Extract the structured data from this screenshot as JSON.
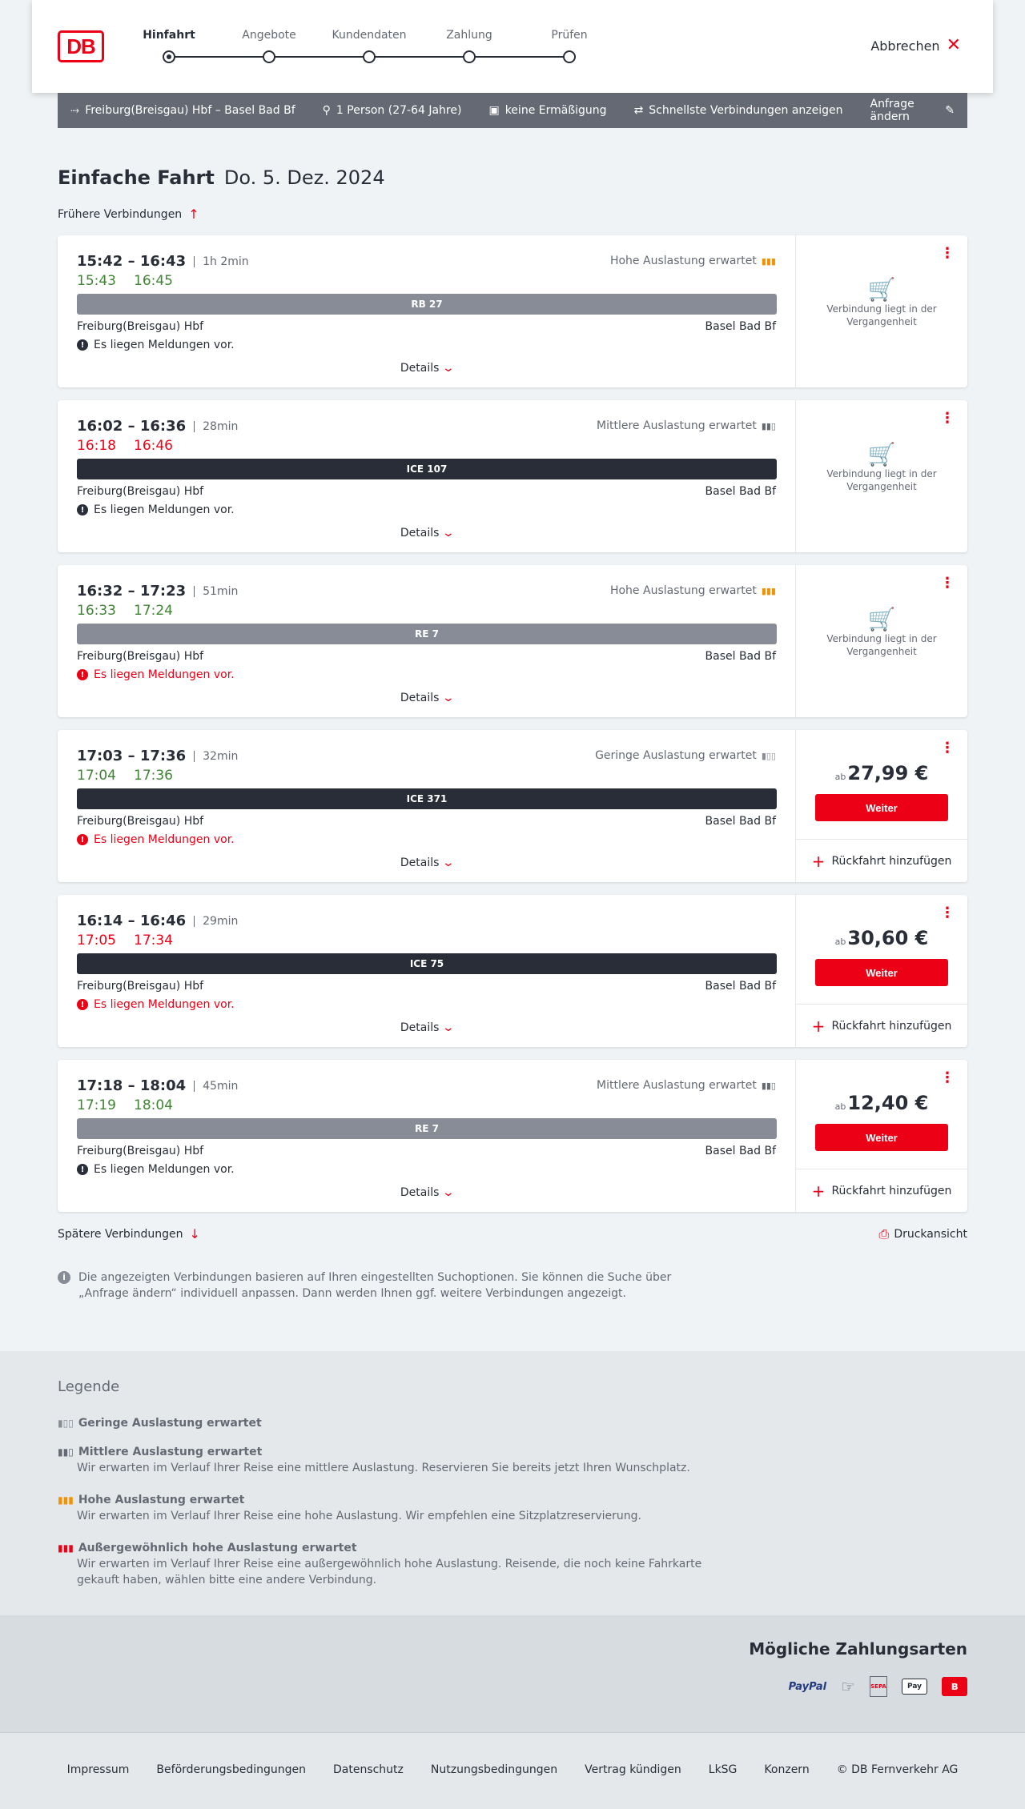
{
  "header": {
    "logo": "DB",
    "cancel_label": "Abbrechen",
    "steps": [
      {
        "label": "Hinfahrt"
      },
      {
        "label": "Angebote"
      },
      {
        "label": "Kundendaten"
      },
      {
        "label": "Zahlung"
      },
      {
        "label": "Prüfen"
      }
    ]
  },
  "search": {
    "route": "Freiburg(Breisgau) Hbf – Basel Bad Bf",
    "travellers": "1 Person (27-64 Jahre)",
    "discount": "keine Ermäßigung",
    "filter": "Schnellste Verbindungen anzeigen",
    "change": "Anfrage ändern"
  },
  "title": {
    "trip": "Einfache Fahrt",
    "date": "Do. 5. Dez. 2024"
  },
  "earlier": "Frühere Verbindungen",
  "later": "Spätere Verbindungen",
  "print": "Druckansicht",
  "details_label": "Details",
  "weiter_label": "Weiter",
  "return_label": "Rückfahrt hinzufügen",
  "past_label": "Verbindung liegt in der Vergangenheit",
  "ab_label": "ab",
  "connections": [
    {
      "time": "15:42 – 16:43",
      "duration": "1h 2min",
      "rt_dep": "15:43",
      "rt_arr": "16:45",
      "rt_status": "green",
      "load": "Hohe Auslastung erwartet",
      "load_level": "high",
      "train": "RB 27",
      "train_style": "grey",
      "from": "Freiburg(Breisgau) Hbf",
      "to": "Basel Bad Bf",
      "notice": "Es liegen Meldungen vor.",
      "notice_style": "dark",
      "price": ""
    },
    {
      "time": "16:02 – 16:36",
      "duration": "28min",
      "rt_dep": "16:18",
      "rt_arr": "16:46",
      "rt_status": "red",
      "load": "Mittlere Auslastung erwartet",
      "load_level": "medium",
      "train": "ICE 107",
      "train_style": "dark",
      "from": "Freiburg(Breisgau) Hbf",
      "to": "Basel Bad Bf",
      "notice": "Es liegen Meldungen vor.",
      "notice_style": "dark",
      "price": ""
    },
    {
      "time": "16:32 – 17:23",
      "duration": "51min",
      "rt_dep": "16:33",
      "rt_arr": "17:24",
      "rt_status": "green",
      "load": "Hohe Auslastung erwartet",
      "load_level": "high",
      "train": "RE 7",
      "train_style": "grey",
      "from": "Freiburg(Breisgau) Hbf",
      "to": "Basel Bad Bf",
      "notice": "Es liegen Meldungen vor.",
      "notice_style": "red",
      "price": ""
    },
    {
      "time": "17:03 – 17:36",
      "duration": "32min",
      "rt_dep": "17:04",
      "rt_arr": "17:36",
      "rt_status": "green",
      "load": "Geringe Auslastung erwartet",
      "load_level": "low",
      "train": "ICE 371",
      "train_style": "dark",
      "from": "Freiburg(Breisgau) Hbf",
      "to": "Basel Bad Bf",
      "notice": "Es liegen Meldungen vor.",
      "notice_style": "red",
      "price": "27,99 €"
    },
    {
      "time": "16:14 – 16:46",
      "duration": "29min",
      "rt_dep": "17:05",
      "rt_arr": "17:34",
      "rt_status": "red",
      "load": "",
      "load_level": "",
      "train": "ICE 75",
      "train_style": "dark",
      "from": "Freiburg(Breisgau) Hbf",
      "to": "Basel Bad Bf",
      "notice": "Es liegen Meldungen vor.",
      "notice_style": "red",
      "price": "30,60 €"
    },
    {
      "time": "17:18 – 18:04",
      "duration": "45min",
      "rt_dep": "17:19",
      "rt_arr": "18:04",
      "rt_status": "green",
      "load": "Mittlere Auslastung erwartet",
      "load_level": "medium",
      "train": "RE 7",
      "train_style": "grey",
      "from": "Freiburg(Breisgau) Hbf",
      "to": "Basel Bad Bf",
      "notice": "Es liegen Meldungen vor.",
      "notice_style": "dark",
      "price": "12,40 €"
    }
  ],
  "info_text": "Die angezeigten Verbindungen basieren auf Ihren eingestellten Suchoptionen. Sie können die Suche über „Anfrage ändern“ individuell anpassen. Dann werden Ihnen ggf. weitere Verbindungen angezeigt.",
  "legend": {
    "title": "Legende",
    "items": [
      {
        "label": "Geringe Auslastung erwartet",
        "text": ""
      },
      {
        "label": "Mittlere Auslastung erwartet",
        "text": "Wir erwarten im Verlauf Ihrer Reise eine mittlere Auslastung. Reservieren Sie bereits jetzt Ihren Wunschplatz."
      },
      {
        "label": "Hohe Auslastung erwartet",
        "text": "Wir erwarten im Verlauf Ihrer Reise eine hohe Auslastung. Wir empfehlen eine Sitzplatzreservierung."
      },
      {
        "label": "Außergewöhnlich hohe Auslastung erwartet",
        "text": "Wir erwarten im Verlauf Ihrer Reise eine außergewöhnlich hohe Auslastung. Reisende, die noch keine Fahrkarte gekauft haben, wählen bitte eine andere Verbindung."
      }
    ]
  },
  "payment": {
    "title": "Mögliche Zahlungsarten",
    "paypal": "PayPal",
    "sepa": "SEPA",
    "applepay": "Pay"
  },
  "footer": [
    "Impressum",
    "Beförderungsbedingungen",
    "Datenschutz",
    "Nutzungsbedingungen",
    "Vertrag kündigen",
    "LkSG",
    "Konzern",
    "© DB Fernverkehr AG"
  ],
  "colors": {
    "db_red": "#ec0016",
    "dark": "#282d37",
    "grey": "#878c96",
    "green": "#408335",
    "load_high": "#f39200"
  }
}
